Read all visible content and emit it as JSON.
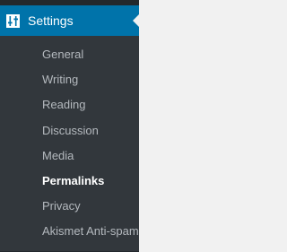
{
  "menu": {
    "header": {
      "label": "Settings",
      "icon": "settings-sliders-icon"
    },
    "items": [
      {
        "label": "General",
        "current": false
      },
      {
        "label": "Writing",
        "current": false
      },
      {
        "label": "Reading",
        "current": false
      },
      {
        "label": "Discussion",
        "current": false
      },
      {
        "label": "Media",
        "current": false
      },
      {
        "label": "Permalinks",
        "current": true
      },
      {
        "label": "Privacy",
        "current": false
      },
      {
        "label": "Akismet Anti-spam",
        "current": false
      }
    ]
  },
  "colors": {
    "sidebar_bg": "#23282d",
    "submenu_bg": "#32373c",
    "active_bg": "#0073aa",
    "content_bg": "#f1f1f1",
    "item_text": "#b4b9be",
    "current_text": "#ffffff"
  }
}
